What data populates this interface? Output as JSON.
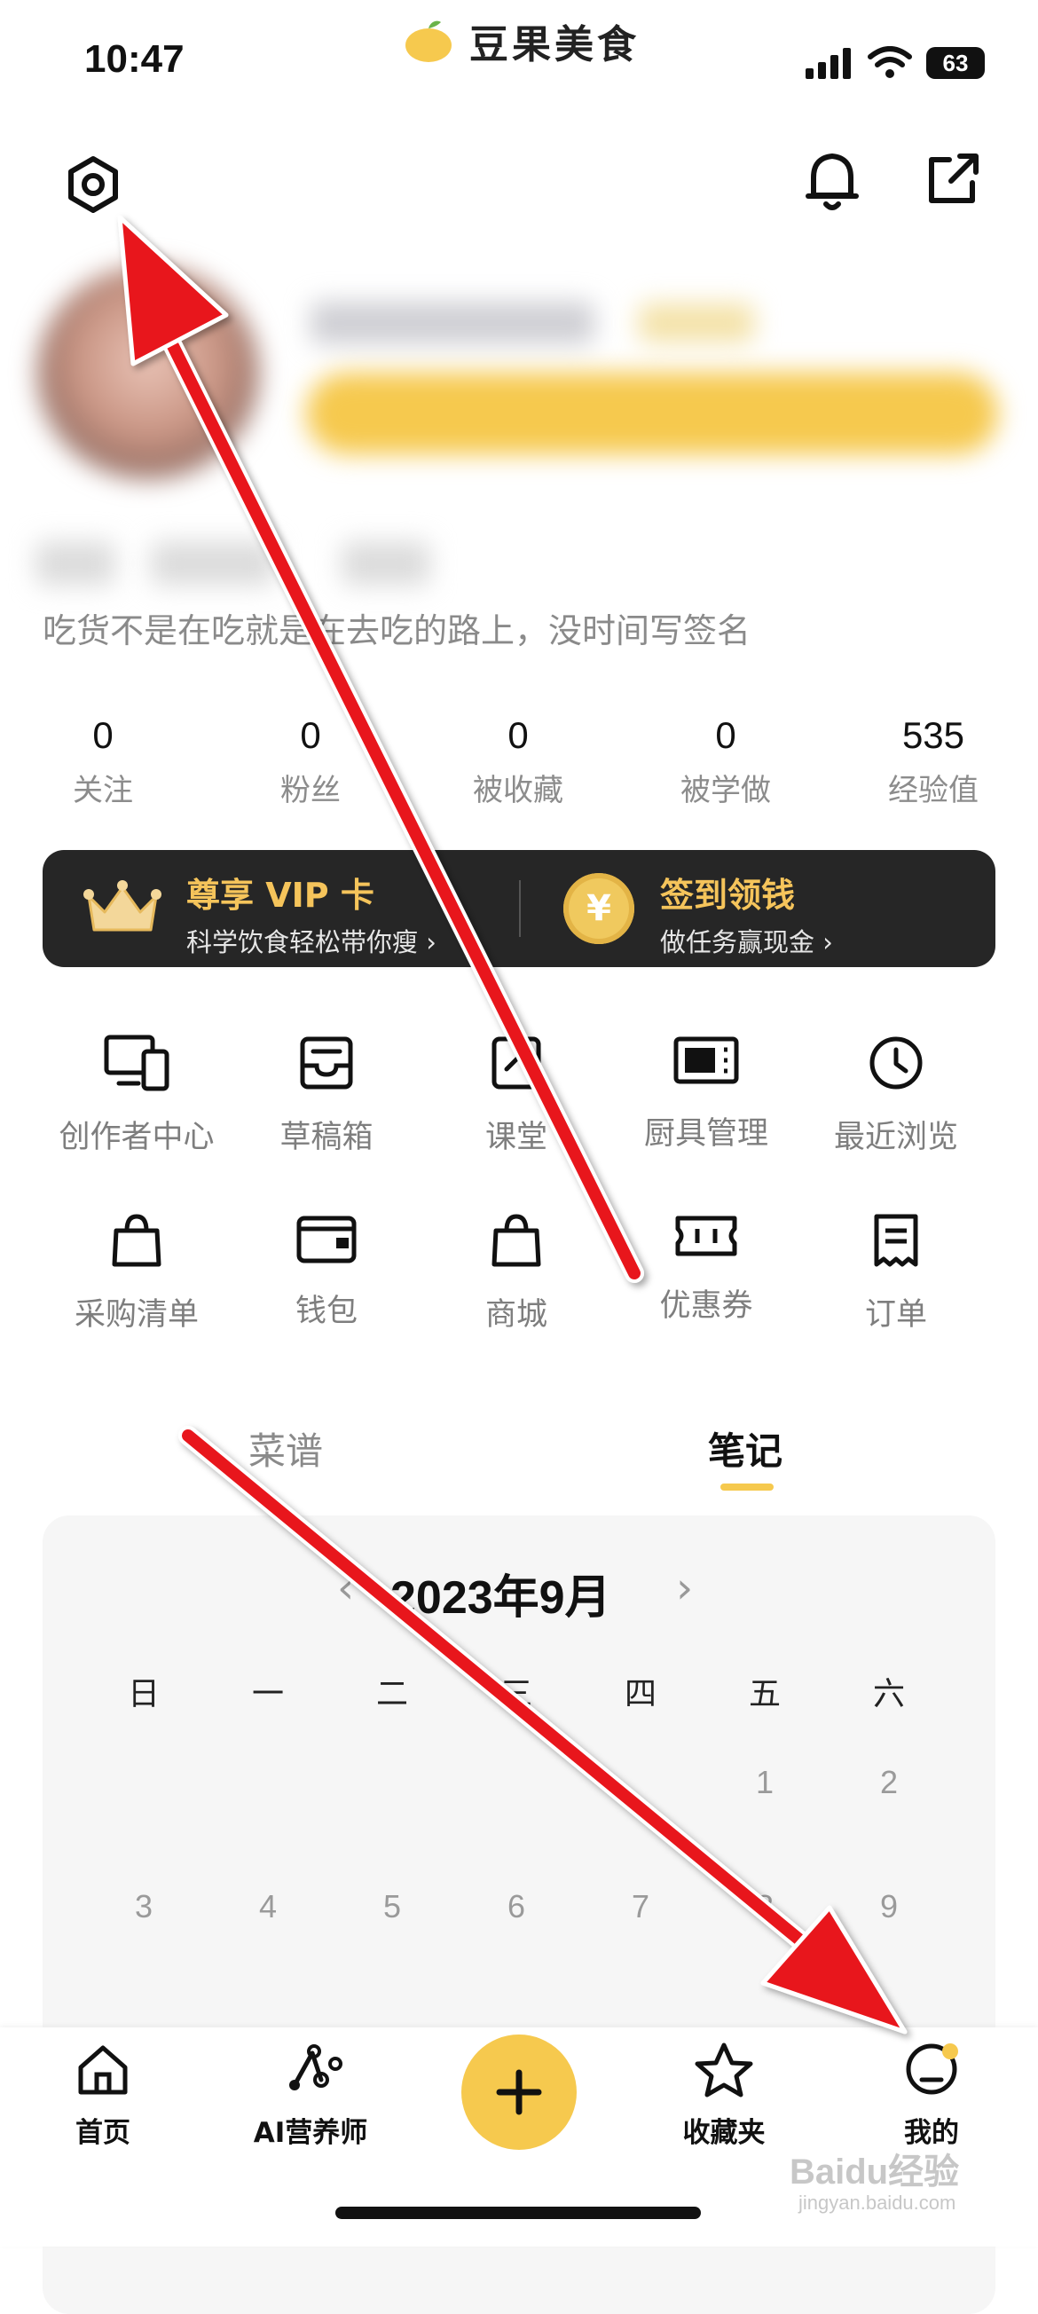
{
  "status_bar": {
    "time": "10:47",
    "battery": "63"
  },
  "app": {
    "title": "豆果美食"
  },
  "profile": {
    "signature": "吃货不是在吃就是在去吃的路上，没时间写签名"
  },
  "stats": [
    {
      "value": "0",
      "label": "关注"
    },
    {
      "value": "0",
      "label": "粉丝"
    },
    {
      "value": "0",
      "label": "被收藏"
    },
    {
      "value": "0",
      "label": "被学做"
    },
    {
      "value": "535",
      "label": "经验值"
    }
  ],
  "promo": {
    "vip_title": "尊享 VIP 卡",
    "vip_sub": "科学饮食轻松带你瘦",
    "checkin_title": "签到领钱",
    "checkin_sub": "做任务赢现金",
    "coin_symbol": "¥"
  },
  "grid": [
    {
      "label": "创作者中心",
      "icon": "devices-icon"
    },
    {
      "label": "草稿箱",
      "icon": "inbox-icon"
    },
    {
      "label": "课堂",
      "icon": "classroom-icon"
    },
    {
      "label": "厨具管理",
      "icon": "microwave-icon"
    },
    {
      "label": "最近浏览",
      "icon": "clock-icon"
    },
    {
      "label": "采购清单",
      "icon": "shopping-bag-icon"
    },
    {
      "label": "钱包",
      "icon": "wallet-icon"
    },
    {
      "label": "商城",
      "icon": "shop-bag-icon"
    },
    {
      "label": "优惠券",
      "icon": "ticket-icon"
    },
    {
      "label": "订单",
      "icon": "receipt-icon"
    }
  ],
  "tabs": {
    "recipes": "菜谱",
    "notes": "笔记",
    "active": "notes"
  },
  "calendar": {
    "month": "2023年9月",
    "weekdays": [
      "日",
      "一",
      "二",
      "三",
      "四",
      "五",
      "六"
    ],
    "row1": [
      "1",
      "2"
    ],
    "row2": [
      "3",
      "4",
      "5",
      "6",
      "7",
      "8",
      "9"
    ]
  },
  "bottom_nav": {
    "home": "首页",
    "ai": "AI营养师",
    "favorites": "收藏夹",
    "me": "我的"
  },
  "watermark": {
    "main": "Baidu经验",
    "sub": "jingyan.baidu.com"
  },
  "colors": {
    "accent": "#f6c94e",
    "arrow": "#e8141b",
    "promo_bg": "#262626"
  }
}
